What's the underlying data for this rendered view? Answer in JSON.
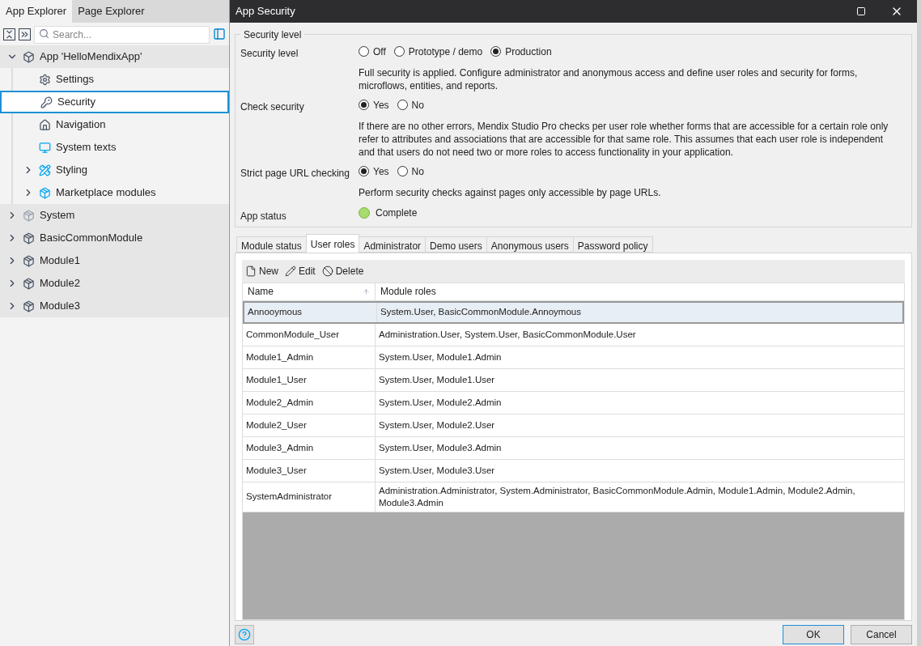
{
  "explorer": {
    "tabs": [
      {
        "label": "App Explorer",
        "selected": true
      },
      {
        "label": "Page Explorer",
        "selected": false
      }
    ],
    "search": {
      "placeholder": "Search..."
    },
    "tree": [
      {
        "label": "App 'HelloMendixApp'",
        "kind": "app",
        "expanded": true,
        "selected": false,
        "children": [
          {
            "label": "Settings",
            "kind": "settings",
            "selected": false
          },
          {
            "label": "Security",
            "kind": "security",
            "selected": true
          },
          {
            "label": "Navigation",
            "kind": "navigation",
            "selected": false
          },
          {
            "label": "System texts",
            "kind": "texts",
            "selected": false
          },
          {
            "label": "Styling",
            "kind": "styling",
            "expanded": false,
            "selected": false
          },
          {
            "label": "Marketplace modules",
            "kind": "marketplace",
            "expanded": false,
            "selected": false
          }
        ]
      },
      {
        "label": "System",
        "kind": "system",
        "expanded": false,
        "selected": false
      },
      {
        "label": "BasicCommonModule",
        "kind": "module",
        "expanded": false,
        "selected": false
      },
      {
        "label": "Module1",
        "kind": "module",
        "expanded": false,
        "selected": false
      },
      {
        "label": "Module2",
        "kind": "module",
        "expanded": false,
        "selected": false
      },
      {
        "label": "Module3",
        "kind": "module",
        "expanded": false,
        "selected": false
      }
    ]
  },
  "dialog": {
    "title": "App Security",
    "group_title": "Security level",
    "settings": [
      {
        "label": "Security level",
        "options": [
          {
            "label": "Off",
            "selected": false
          },
          {
            "label": "Prototype / demo",
            "selected": false
          },
          {
            "label": "Production",
            "selected": true
          }
        ],
        "description": "Full security is applied. Configure administrator and anonymous access and define user roles and security for forms, microflows, entities, and reports."
      },
      {
        "label": "Check security",
        "options": [
          {
            "label": "Yes",
            "selected": true
          },
          {
            "label": "No",
            "selected": false
          }
        ],
        "description": "If there are no other errors, Mendix Studio Pro checks per user role whether forms that are accessible for a certain role only refer to attributes and associations that are accessible for that same role. This assumes that each user role is independent and that users do not need two or more roles to access functionality in your application."
      },
      {
        "label": "Strict page URL checking",
        "options": [
          {
            "label": "Yes",
            "selected": true
          },
          {
            "label": "No",
            "selected": false
          }
        ],
        "description": "Perform security checks against pages only accessible by page URLs."
      }
    ],
    "app_status": {
      "label": "App status",
      "value": "Complete",
      "color": "#a8dc6c"
    },
    "tabs": [
      {
        "label": "Module status",
        "selected": false
      },
      {
        "label": "User roles",
        "selected": true
      },
      {
        "label": "Administrator",
        "selected": false
      },
      {
        "label": "Demo users",
        "selected": false
      },
      {
        "label": "Anonymous users",
        "selected": false
      },
      {
        "label": "Password policy",
        "selected": false
      }
    ],
    "toolbar": [
      {
        "label": "New",
        "kind": "new"
      },
      {
        "label": "Edit",
        "kind": "edit"
      },
      {
        "label": "Delete",
        "kind": "delete"
      }
    ],
    "table": {
      "columns": [
        "Name",
        "Module roles"
      ],
      "rows": [
        {
          "name": "Annooymous",
          "roles": "System.User, BasicCommonModule.Annoymous",
          "selected": true
        },
        {
          "name": "CommonModule_User",
          "roles": "Administration.User, System.User, BasicCommonModule.User",
          "selected": false
        },
        {
          "name": "Module1_Admin",
          "roles": "System.User, Module1.Admin",
          "selected": false
        },
        {
          "name": "Module1_User",
          "roles": "System.User, Module1.User",
          "selected": false
        },
        {
          "name": "Module2_Admin",
          "roles": "System.User, Module2.Admin",
          "selected": false
        },
        {
          "name": "Module2_User",
          "roles": "System.User, Module2.User",
          "selected": false
        },
        {
          "name": "Module3_Admin",
          "roles": "System.User, Module3.Admin",
          "selected": false
        },
        {
          "name": "Module3_User",
          "roles": "System.User, Module3.User",
          "selected": false
        },
        {
          "name": "SystemAdministrator",
          "roles": "Administration.Administrator, System.Administrator, BasicCommonModule.Admin, Module1.Admin, Module2.Admin, Module3.Admin",
          "selected": false
        }
      ]
    },
    "buttons": [
      {
        "label": "OK",
        "kind": "primary"
      },
      {
        "label": "Cancel",
        "kind": "normal"
      }
    ]
  }
}
